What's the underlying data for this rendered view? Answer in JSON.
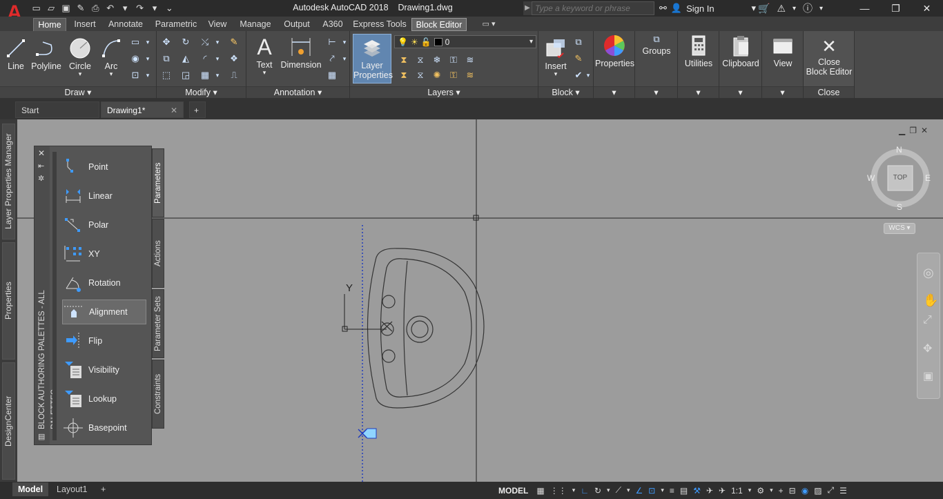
{
  "app": {
    "title": "Autodesk AutoCAD 2018",
    "filename": "Drawing1.dwg",
    "logo_letter": "A"
  },
  "search": {
    "placeholder": "Type a keyword or phrase"
  },
  "account": {
    "signin": "Sign In"
  },
  "ribbon_tabs": [
    "Home",
    "Insert",
    "Annotate",
    "Parametric",
    "View",
    "Manage",
    "Output",
    "A360",
    "Express Tools",
    "Block Editor"
  ],
  "ribbon_active_tab": "Home",
  "ribbon": {
    "draw": {
      "label": "Draw",
      "line": "Line",
      "polyline": "Polyline",
      "circle": "Circle",
      "arc": "Arc"
    },
    "modify": {
      "label": "Modify"
    },
    "annotation": {
      "label": "Annotation",
      "text": "Text",
      "dimension": "Dimension"
    },
    "layers": {
      "label": "Layers",
      "layer_properties": "Layer Properties",
      "current_layer": "0"
    },
    "block": {
      "label": "Block",
      "insert": "Insert"
    },
    "properties": {
      "label": "Properties"
    },
    "groups": {
      "label": "Groups"
    },
    "utilities": {
      "label": "Utilities"
    },
    "clipboard": {
      "label": "Clipboard"
    },
    "view": {
      "label": "View"
    },
    "close": {
      "btn_line1": "Close",
      "btn_line2": "Block Editor",
      "label": "Close"
    }
  },
  "doc_tabs": {
    "start": "Start",
    "drawing": "Drawing1*"
  },
  "left_palettes": [
    "Layer Properties Manager",
    "Properties",
    "DesignCenter"
  ],
  "block_palette": {
    "title": "BLOCK AUTHORING PALETTES - ALL PALETTES",
    "items": [
      "Point",
      "Linear",
      "Polar",
      "XY",
      "Rotation",
      "Alignment",
      "Flip",
      "Visibility",
      "Lookup",
      "Basepoint"
    ],
    "selected": "Alignment",
    "tabs": [
      "Parameters",
      "Actions",
      "Parameter Sets",
      "Constraints"
    ]
  },
  "viewcube": {
    "n": "N",
    "s": "S",
    "e": "E",
    "w": "W",
    "face": "TOP",
    "wcs": "WCS"
  },
  "axis": {
    "y_label": "Y"
  },
  "layout_tabs": [
    "Model",
    "Layout1"
  ],
  "status": {
    "mode": "MODEL",
    "scale": "1:1"
  },
  "colors": {
    "accent": "#3e9bff",
    "logo_red": "#e02b2b",
    "canvas": "#9c9c9c"
  }
}
